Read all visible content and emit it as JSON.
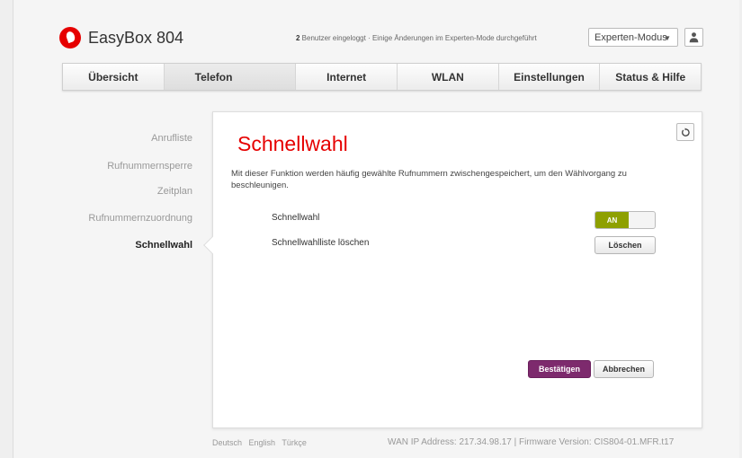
{
  "header": {
    "brand": "EasyBox 804",
    "users_count": "2",
    "status_text": " Benutzer eingeloggt · Einige Änderungen im Experten-Mode durchgeführt",
    "mode_select": "Experten-Modus"
  },
  "nav": {
    "tabs": [
      {
        "label": "Übersicht"
      },
      {
        "label": "Telefon"
      },
      {
        "label": "Internet"
      },
      {
        "label": "WLAN"
      },
      {
        "label": "Einstellungen"
      },
      {
        "label": "Status & Hilfe"
      }
    ]
  },
  "sidebar": {
    "items": [
      {
        "label": "Anrufliste"
      },
      {
        "label": "Rufnummernsperre"
      },
      {
        "label": "Zeitplan"
      },
      {
        "label": "Rufnummernzuordnung"
      },
      {
        "label": "Schnellwahl"
      }
    ]
  },
  "panel": {
    "title": "Schnellwahl",
    "description": "Mit dieser Funktion werden häufig gewählte Rufnummern zwischengespeichert, um den Wählvorgang zu beschleunigen.",
    "row_schnellwahl": "Schnellwahl",
    "toggle_state": "AN",
    "row_delete": "Schnellwahlliste löschen",
    "delete_button": "Löschen",
    "confirm_button": "Bestätigen",
    "cancel_button": "Abbrechen"
  },
  "footer": {
    "languages": [
      "Deutsch",
      "English",
      "Türkçe"
    ],
    "info": "WAN IP Address: 217.34.98.17 | Firmware Version: CIS804-01.MFR.t17"
  },
  "colors": {
    "brand_red": "#e60000",
    "toggle_on": "#8ea000",
    "primary_button": "#7d2a6d"
  }
}
